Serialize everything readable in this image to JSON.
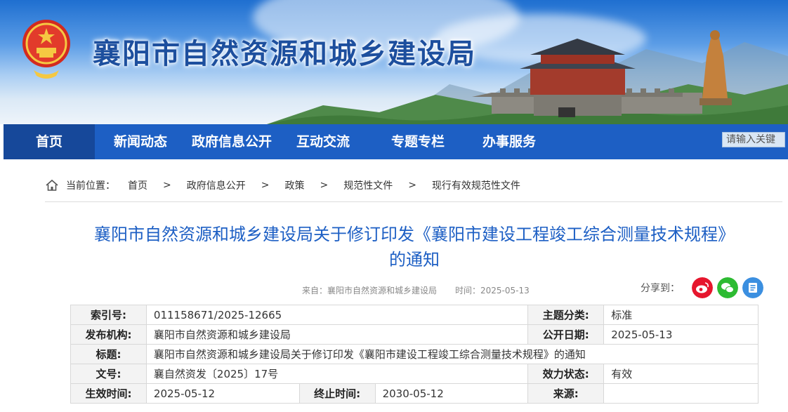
{
  "site": {
    "title": "襄阳市自然资源和城乡建设局"
  },
  "nav": {
    "items": [
      "首页",
      "新闻动态",
      "政府信息公开",
      "互动交流",
      "专题专栏",
      "办事服务"
    ],
    "search_placeholder": "请输入关键"
  },
  "breadcrumb": {
    "label": "当前位置：",
    "items": [
      "首页",
      "政府信息公开",
      "政策",
      "规范性文件",
      "现行有效规范性文件"
    ],
    "separator": ">"
  },
  "article": {
    "title_line1": "襄阳市自然资源和城乡建设局关于修订印发《襄阳市建设工程竣工综合测量技术规程》",
    "title_line2": "的通知",
    "source": "来自：襄阳市自然资源和城乡建设局",
    "time": "时间：2025-05-13"
  },
  "share": {
    "label": "分享到：",
    "buttons": [
      {
        "name": "weibo",
        "color": "#e6162d"
      },
      {
        "name": "wechat",
        "color": "#2dbb32"
      },
      {
        "name": "qzone",
        "color": "#3b8fe0"
      }
    ]
  },
  "info": {
    "index_label": "索引号:",
    "index_value": "011158671/2025-12665",
    "topic_label": "主题分类:",
    "topic_value": "标准",
    "publisher_label": "发布机构:",
    "publisher_value": "襄阳市自然资源和城乡建设局",
    "pubdate_label": "公开日期:",
    "pubdate_value": "2025-05-13",
    "title_label": "标题:",
    "title_value": "襄阳市自然资源和城乡建设局关于修订印发《襄阳市建设工程竣工综合测量技术规程》的通知",
    "docno_label": "文号:",
    "docno_value": "襄自然资发〔2025〕17号",
    "status_label": "效力状态:",
    "status_value": "有效",
    "effective_label": "生效时间:",
    "effective_value": "2025-05-12",
    "end_label": "终止时间:",
    "end_value": "2030-05-12",
    "origin_label": "来源:",
    "origin_value": ""
  },
  "colors": {
    "nav": "#1d5fc4",
    "title": "#1d5fc4",
    "site_title": "#1d4f9e"
  }
}
